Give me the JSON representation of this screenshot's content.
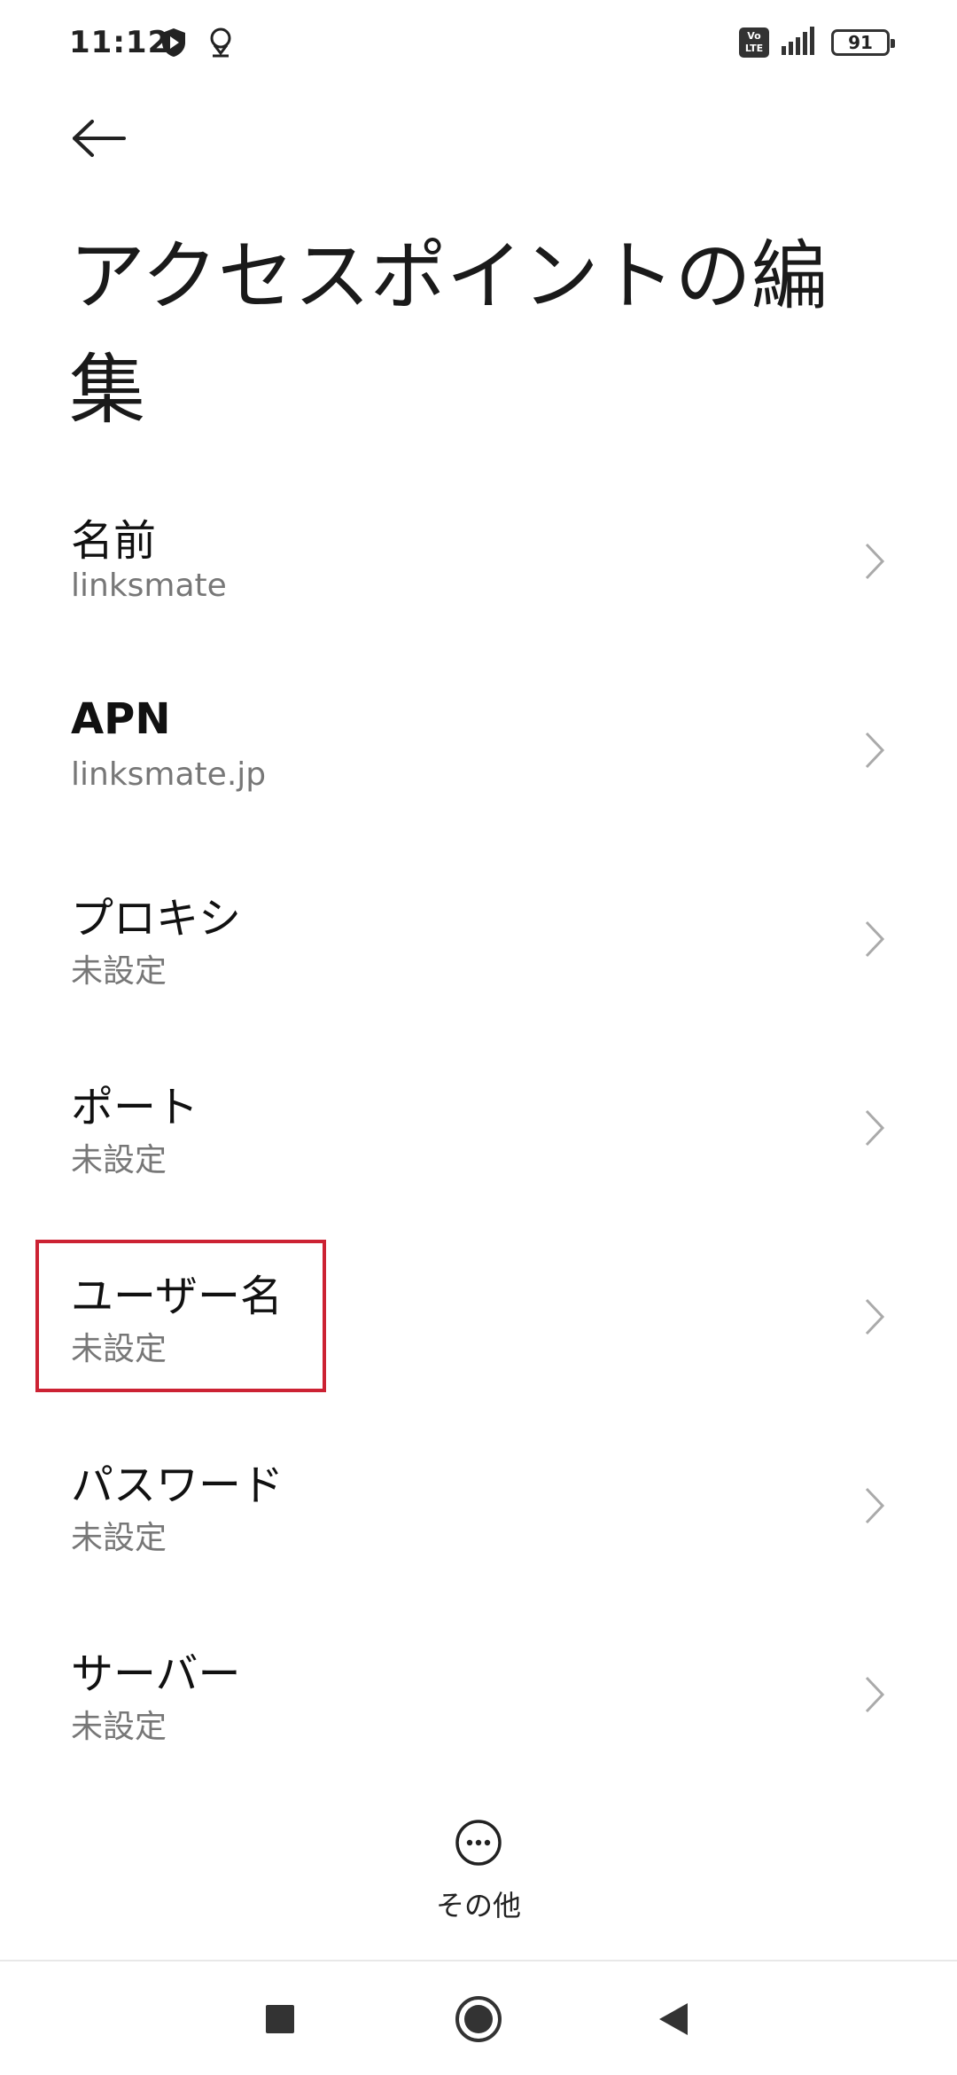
{
  "status_bar": {
    "time": "11:12",
    "volte": "Vo LTE",
    "battery": "91",
    "icons": [
      "shield-play-icon",
      "location-pin-icon",
      "volte-icon",
      "signal-icon",
      "battery-icon"
    ]
  },
  "header": {
    "back_icon": "back-arrow-icon",
    "title": "アクセスポイントの編集"
  },
  "settings": [
    {
      "label": "名前",
      "value": "linksmate"
    },
    {
      "label": "APN",
      "value": "linksmate.jp"
    },
    {
      "label": "プロキシ",
      "value": "未設定"
    },
    {
      "label": "ポート",
      "value": "未設定"
    },
    {
      "label": "ユーザー名",
      "value": "未設定"
    },
    {
      "label": "パスワード",
      "value": "未設定"
    },
    {
      "label": "サーバー",
      "value": "未設定"
    }
  ],
  "highlight": {
    "target": "ユーザー名",
    "color": "#cc2233"
  },
  "more": {
    "icon": "more-dots-icon",
    "label": "その他"
  },
  "navigation": {
    "icons": [
      "recents-square-icon",
      "home-circle-icon",
      "back-triangle-icon"
    ]
  }
}
